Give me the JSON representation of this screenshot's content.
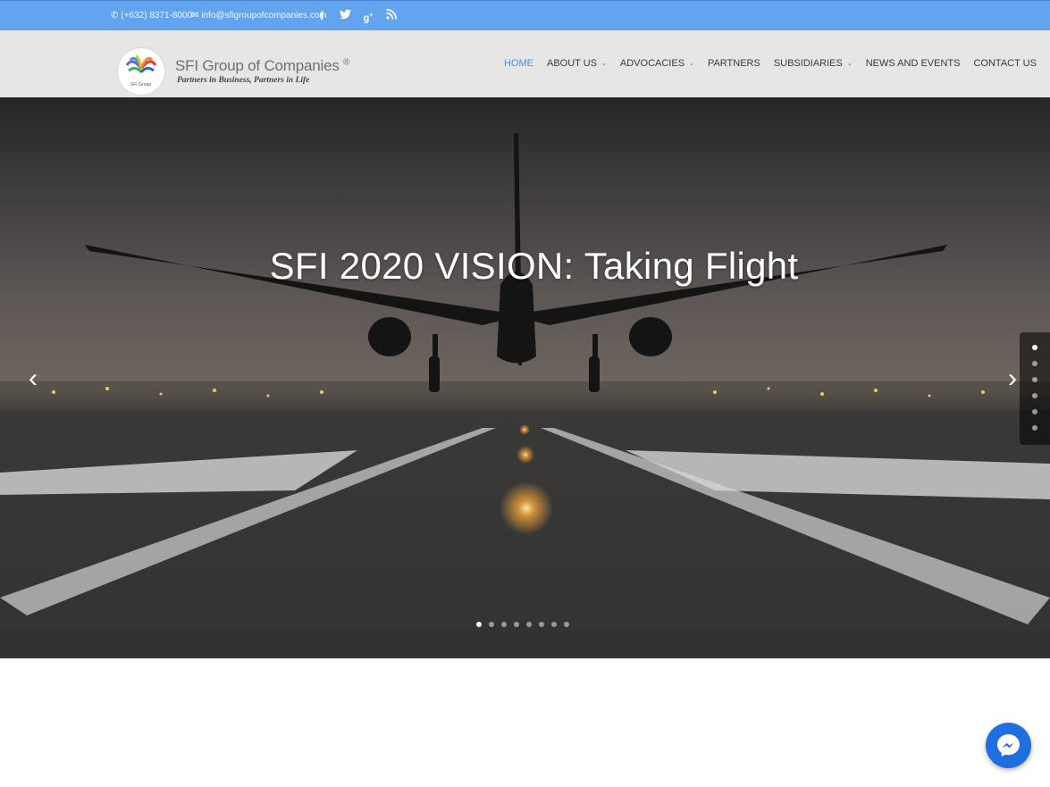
{
  "topbar": {
    "phone": "(+632) 8371-8000",
    "email": "info@sfigroupofcompanies.com",
    "social_icons": [
      "facebook-icon",
      "twitter-icon",
      "google-plus-icon",
      "rss-icon"
    ]
  },
  "header": {
    "brand": "SFI Group of Companies",
    "brand_mark": "®",
    "tagline": "Partners in Business, Partners in Life",
    "logo_small_text": "SFI Group"
  },
  "nav": {
    "items": [
      {
        "label": "HOME",
        "active": true,
        "has_dropdown": false
      },
      {
        "label": "ABOUT US",
        "active": false,
        "has_dropdown": true
      },
      {
        "label": "ADVOCACIES",
        "active": false,
        "has_dropdown": true
      },
      {
        "label": "PARTNERS",
        "active": false,
        "has_dropdown": false
      },
      {
        "label": "SUBSIDIARIES",
        "active": false,
        "has_dropdown": true
      },
      {
        "label": "NEWS AND EVENTS",
        "active": false,
        "has_dropdown": false
      },
      {
        "label": "CONTACT US",
        "active": false,
        "has_dropdown": false
      }
    ]
  },
  "hero": {
    "title": "SFI 2020 VISION: Taking Flight",
    "prev_glyph": "‹",
    "next_glyph": "›",
    "slide_count": 8,
    "active_slide": 1,
    "side_nav_count": 6,
    "side_nav_active": 1
  },
  "colors": {
    "topbar": "#63a4f0",
    "nav_active": "#4d8fe0",
    "messenger": "#1f6fe0"
  }
}
